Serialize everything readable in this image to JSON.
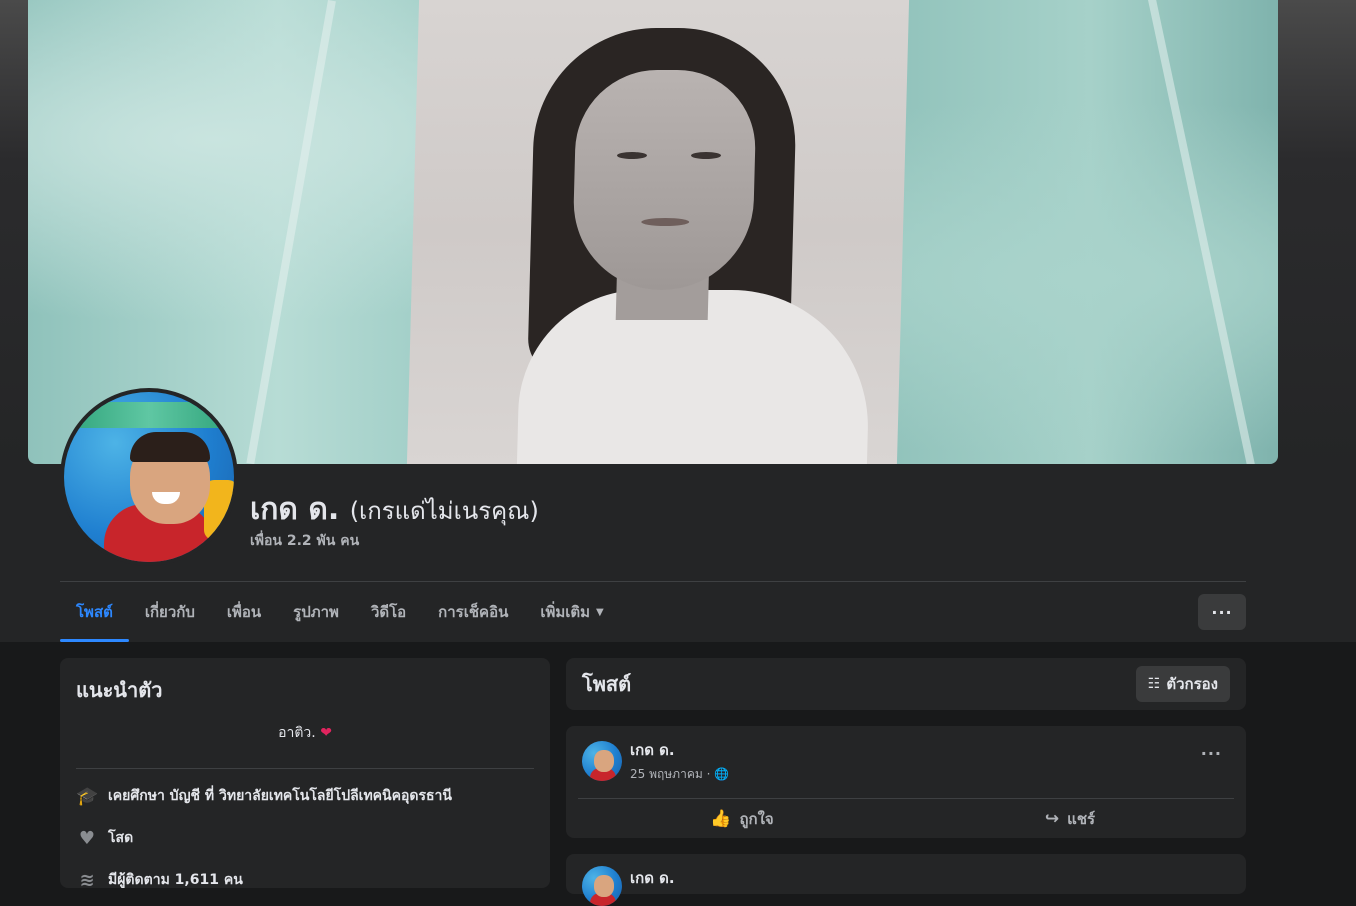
{
  "profile": {
    "name": "เกด ด.",
    "alternate_name": "(เกรแด่ไม่เนรคุณ)",
    "friends": "เพื่อน 2.2 พัน คน"
  },
  "tabs": [
    {
      "label": "โพสต์"
    },
    {
      "label": "เกี่ยวกับ"
    },
    {
      "label": "เพื่อน"
    },
    {
      "label": "รูปภาพ"
    },
    {
      "label": "วิดีโอ"
    },
    {
      "label": "การเช็คอิน"
    },
    {
      "label": "เพิ่มเติม"
    }
  ],
  "tabs_more_label": "···",
  "intro": {
    "title": "แนะนำตัว",
    "bio": "อาติว.",
    "bio_emoji": "❤",
    "education": "เคยศึกษา บัญชี ที่ วิทยาลัยเทคโนโลยีโปลีเทคนิคอุดรธานี",
    "relationship": "โสด",
    "followers": "มีผู้ติดตาม 1,611 คน"
  },
  "posts_header": {
    "title": "โพสต์",
    "filter_label": "ตัวกรอง"
  },
  "post": {
    "author": "เกด ด.",
    "date": "25 พฤษภาคม ·",
    "more": "···",
    "like_label": "ถูกใจ",
    "share_label": "แชร์"
  },
  "post2": {
    "author": "เกด ด."
  },
  "colors": {
    "accent": "#2d88ff",
    "card": "#242526",
    "background": "#18191a"
  }
}
